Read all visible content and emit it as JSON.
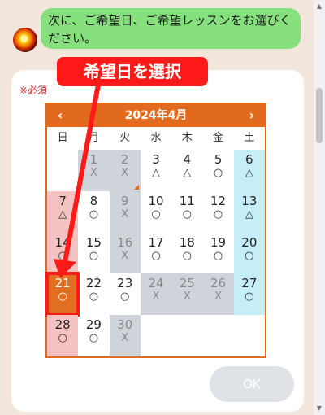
{
  "message": {
    "text": "次に、ご希望日、ご希望レッスンをお選びください。"
  },
  "form": {
    "required_label": "※必須",
    "ok_label": "OK"
  },
  "calendar": {
    "title": "2024年4月",
    "prev_icon": "‹",
    "next_icon": "›",
    "weekdays": [
      "日",
      "月",
      "火",
      "水",
      "木",
      "金",
      "土"
    ],
    "days": [
      {
        "day": "",
        "mark": "",
        "type": "empty"
      },
      {
        "day": "1",
        "mark": "X",
        "type": "gray"
      },
      {
        "day": "2",
        "mark": "X",
        "type": "gray",
        "tri": true
      },
      {
        "day": "3",
        "mark": "△",
        "type": "normal"
      },
      {
        "day": "4",
        "mark": "△",
        "type": "normal"
      },
      {
        "day": "5",
        "mark": "○",
        "type": "normal"
      },
      {
        "day": "6",
        "mark": "△",
        "type": "sat"
      },
      {
        "day": "7",
        "mark": "△",
        "type": "sun"
      },
      {
        "day": "8",
        "mark": "○",
        "type": "normal"
      },
      {
        "day": "9",
        "mark": "X",
        "type": "gray"
      },
      {
        "day": "10",
        "mark": "○",
        "type": "normal"
      },
      {
        "day": "11",
        "mark": "○",
        "type": "normal"
      },
      {
        "day": "12",
        "mark": "○",
        "type": "normal"
      },
      {
        "day": "13",
        "mark": "△",
        "type": "sat"
      },
      {
        "day": "14",
        "mark": "○",
        "type": "sun"
      },
      {
        "day": "15",
        "mark": "○",
        "type": "normal"
      },
      {
        "day": "16",
        "mark": "X",
        "type": "gray"
      },
      {
        "day": "17",
        "mark": "○",
        "type": "normal"
      },
      {
        "day": "18",
        "mark": "○",
        "type": "normal"
      },
      {
        "day": "19",
        "mark": "○",
        "type": "normal"
      },
      {
        "day": "20",
        "mark": "○",
        "type": "sat"
      },
      {
        "day": "21",
        "mark": "○",
        "type": "selected"
      },
      {
        "day": "22",
        "mark": "○",
        "type": "normal"
      },
      {
        "day": "23",
        "mark": "○",
        "type": "normal"
      },
      {
        "day": "24",
        "mark": "X",
        "type": "gray"
      },
      {
        "day": "25",
        "mark": "X",
        "type": "gray"
      },
      {
        "day": "26",
        "mark": "X",
        "type": "gray"
      },
      {
        "day": "27",
        "mark": "○",
        "type": "sat"
      },
      {
        "day": "28",
        "mark": "○",
        "type": "sun"
      },
      {
        "day": "29",
        "mark": "○",
        "type": "normal"
      },
      {
        "day": "30",
        "mark": "X",
        "type": "gray"
      }
    ]
  },
  "annotation": {
    "text": "希望日を選択"
  },
  "colors": {
    "accent": "#e26a1f",
    "annotation": "#ff1a1a",
    "bubble": "#86e07e"
  }
}
